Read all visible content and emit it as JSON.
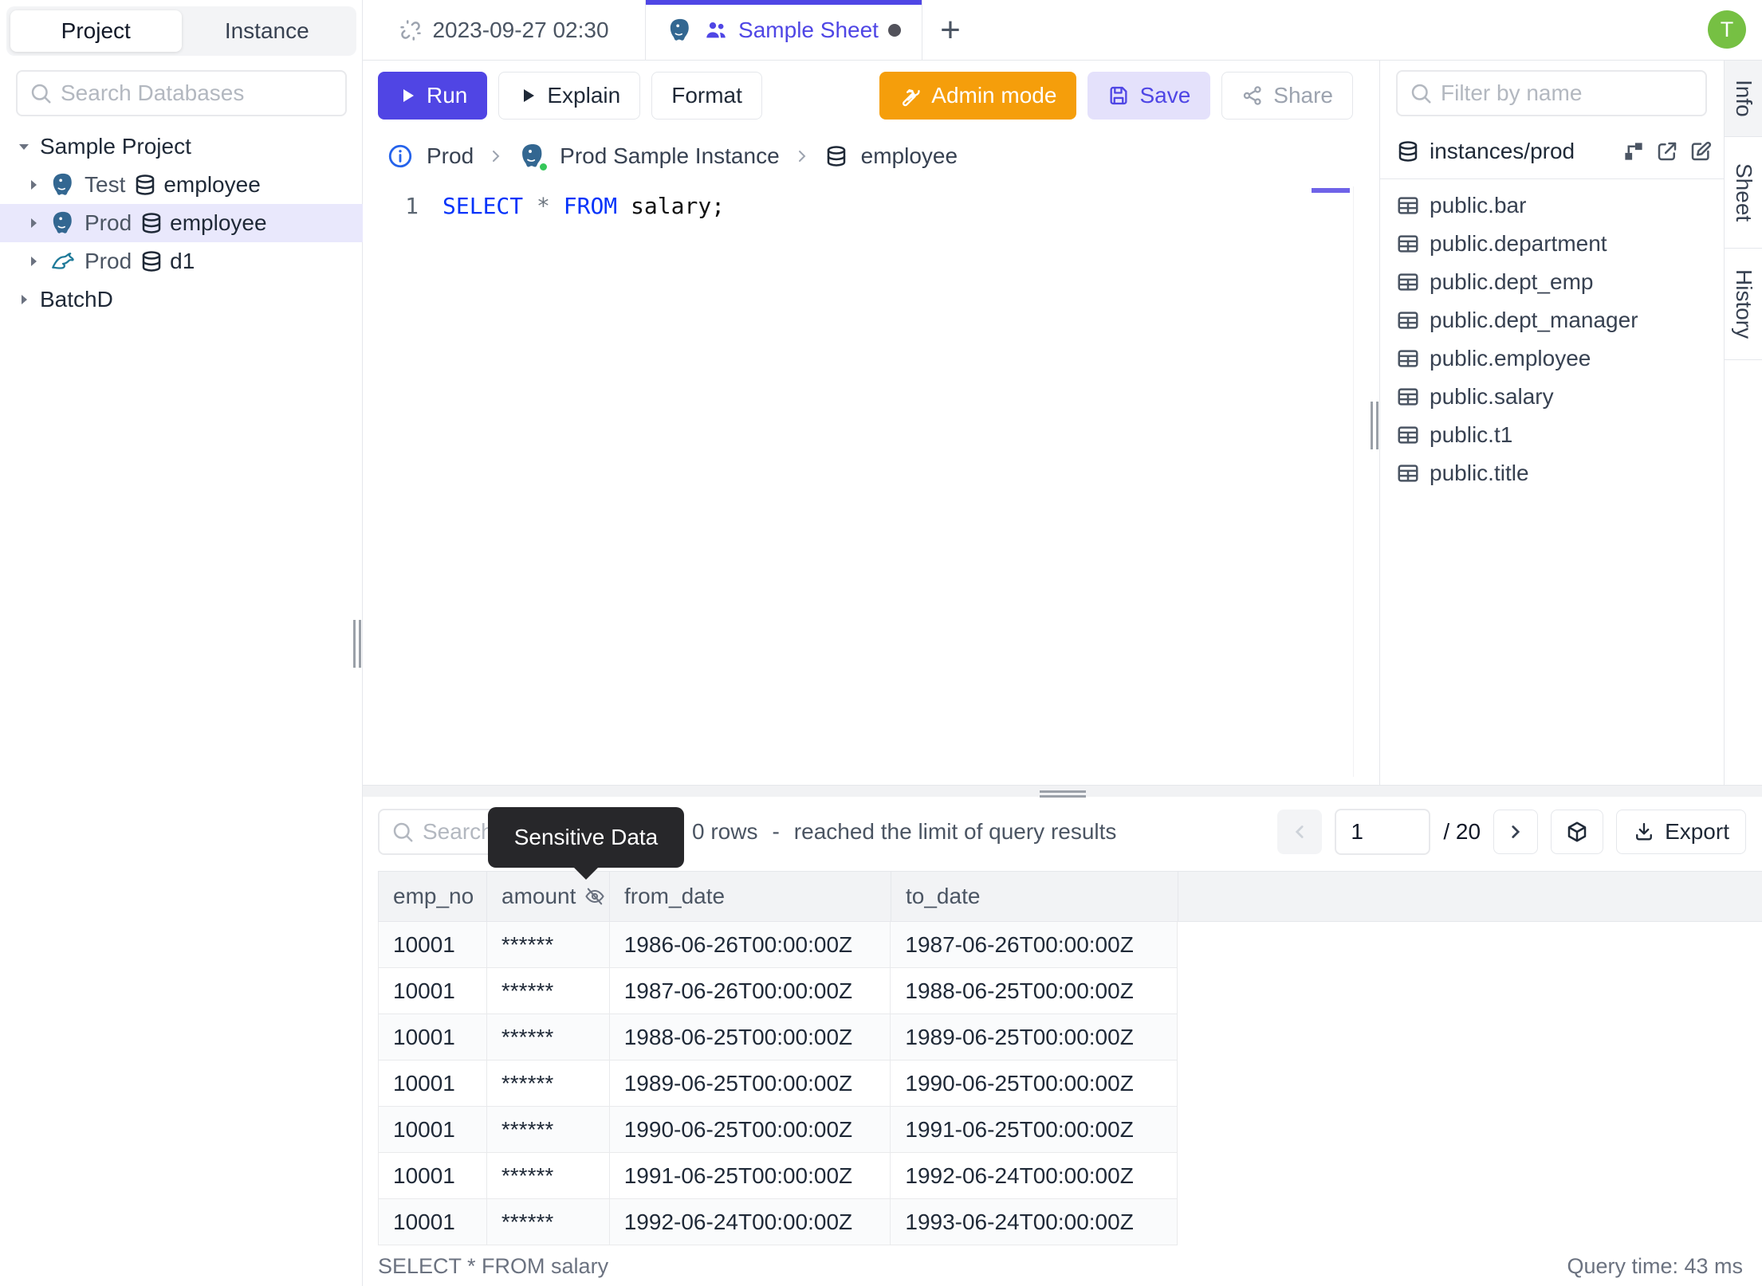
{
  "sidebar": {
    "tabs": [
      {
        "label": "Project"
      },
      {
        "label": "Instance"
      }
    ],
    "search_placeholder": "Search Databases",
    "tree": [
      {
        "label": "Sample Project"
      },
      {
        "env": "Test",
        "db": "employee"
      },
      {
        "env": "Prod",
        "db": "employee"
      },
      {
        "env": "Prod",
        "db": "d1"
      },
      {
        "label": "BatchD"
      }
    ]
  },
  "topbar": {
    "tabs": [
      {
        "label": "2023-09-27 02:30"
      },
      {
        "label": "Sample Sheet"
      }
    ],
    "new_tab": "+",
    "avatar": "T"
  },
  "toolbar": {
    "run": "Run",
    "explain": "Explain",
    "format": "Format",
    "admin_mode": "Admin mode",
    "save": "Save",
    "share": "Share"
  },
  "breadcrumb": {
    "env": "Prod",
    "instance": "Prod Sample Instance",
    "database": "employee"
  },
  "editor": {
    "line_number": "1",
    "kw_select": "SELECT",
    "star": "*",
    "kw_from": "FROM",
    "rest": "salary;"
  },
  "right_panel": {
    "filter_placeholder": "Filter by name",
    "header": "instances/prod",
    "tables": [
      "public.bar",
      "public.department",
      "public.dept_emp",
      "public.dept_manager",
      "public.employee",
      "public.salary",
      "public.t1",
      "public.title"
    ]
  },
  "side_tabs": [
    {
      "label": "Info"
    },
    {
      "label": "Sheet"
    },
    {
      "label": "History"
    }
  ],
  "results": {
    "search_placeholder": "Search",
    "tooltip": "Sensitive Data",
    "rows_count": "0 rows",
    "dash": "-",
    "limit_text": "reached the limit of query results",
    "page_value": "1",
    "page_total": "/ 20",
    "export_label": "Export",
    "columns": [
      "emp_no",
      "amount",
      "from_date",
      "to_date"
    ],
    "rows": [
      [
        "10001",
        "******",
        "1986-06-26T00:00:00Z",
        "1987-06-26T00:00:00Z"
      ],
      [
        "10001",
        "******",
        "1987-06-26T00:00:00Z",
        "1988-06-25T00:00:00Z"
      ],
      [
        "10001",
        "******",
        "1988-06-25T00:00:00Z",
        "1989-06-25T00:00:00Z"
      ],
      [
        "10001",
        "******",
        "1989-06-25T00:00:00Z",
        "1990-06-25T00:00:00Z"
      ],
      [
        "10001",
        "******",
        "1990-06-25T00:00:00Z",
        "1991-06-25T00:00:00Z"
      ],
      [
        "10001",
        "******",
        "1991-06-25T00:00:00Z",
        "1992-06-24T00:00:00Z"
      ],
      [
        "10001",
        "******",
        "1992-06-24T00:00:00Z",
        "1993-06-24T00:00:00Z"
      ]
    ],
    "status_query": "SELECT * FROM salary",
    "query_time": "Query time: 43 ms"
  },
  "colors": {
    "accent": "#4f46e5",
    "admin": "#f59e0b",
    "avatar_green": "#76c043",
    "tooltip_bg": "#27272a"
  }
}
